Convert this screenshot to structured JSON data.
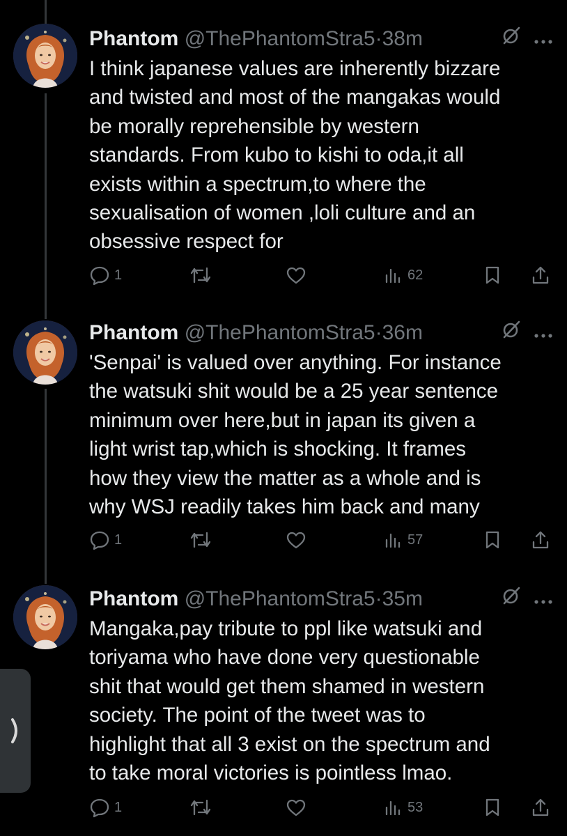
{
  "tweets": [
    {
      "name": "Phantom",
      "handle": "@ThePhantomStra5",
      "separator": "·",
      "time": "38m",
      "text": "I think japanese values are inherently bizzare\nand twisted and most of the mangakas would\nbe morally reprehensible by western\nstandards. From kubo to kishi to oda,it all\nexists within a spectrum,to where the\nsexualisation of women ,loli culture and an\nobsessive respect for",
      "replies": "1",
      "views": "62"
    },
    {
      "name": "Phantom",
      "handle": "@ThePhantomStra5",
      "separator": "·",
      "time": "36m",
      "text": "'Senpai' is valued over anything. For instance\nthe watsuki shit would be a 25 year sentence\nminimum over here,but in japan its given a\nlight wrist tap,which is shocking. It frames\nhow they view the matter as a whole and is\nwhy WSJ readily takes him back and many",
      "replies": "1",
      "views": "57"
    },
    {
      "name": "Phantom",
      "handle": "@ThePhantomStra5",
      "separator": "·",
      "time": "35m",
      "text": "Mangaka,pay tribute to ppl like watsuki and\ntoriyama who have done very questionable\nshit that would get them shamed in western\nsociety. The point of the tweet was to\nhighlight that all 3 exist on the spectrum and\nto take moral victories is pointless lmao.",
      "replies": "1",
      "views": "53"
    }
  ],
  "icons": {
    "header": [
      "grok-icon",
      "more-icon"
    ],
    "actions": [
      "reply-icon",
      "retweet-icon",
      "like-icon",
      "views-icon",
      "bookmark-icon",
      "share-icon"
    ],
    "side_tab": "chevron-right-icon"
  },
  "colors": {
    "background": "#000000",
    "text": "#e7e9ea",
    "muted": "#71767b",
    "thread_line": "#333639"
  }
}
